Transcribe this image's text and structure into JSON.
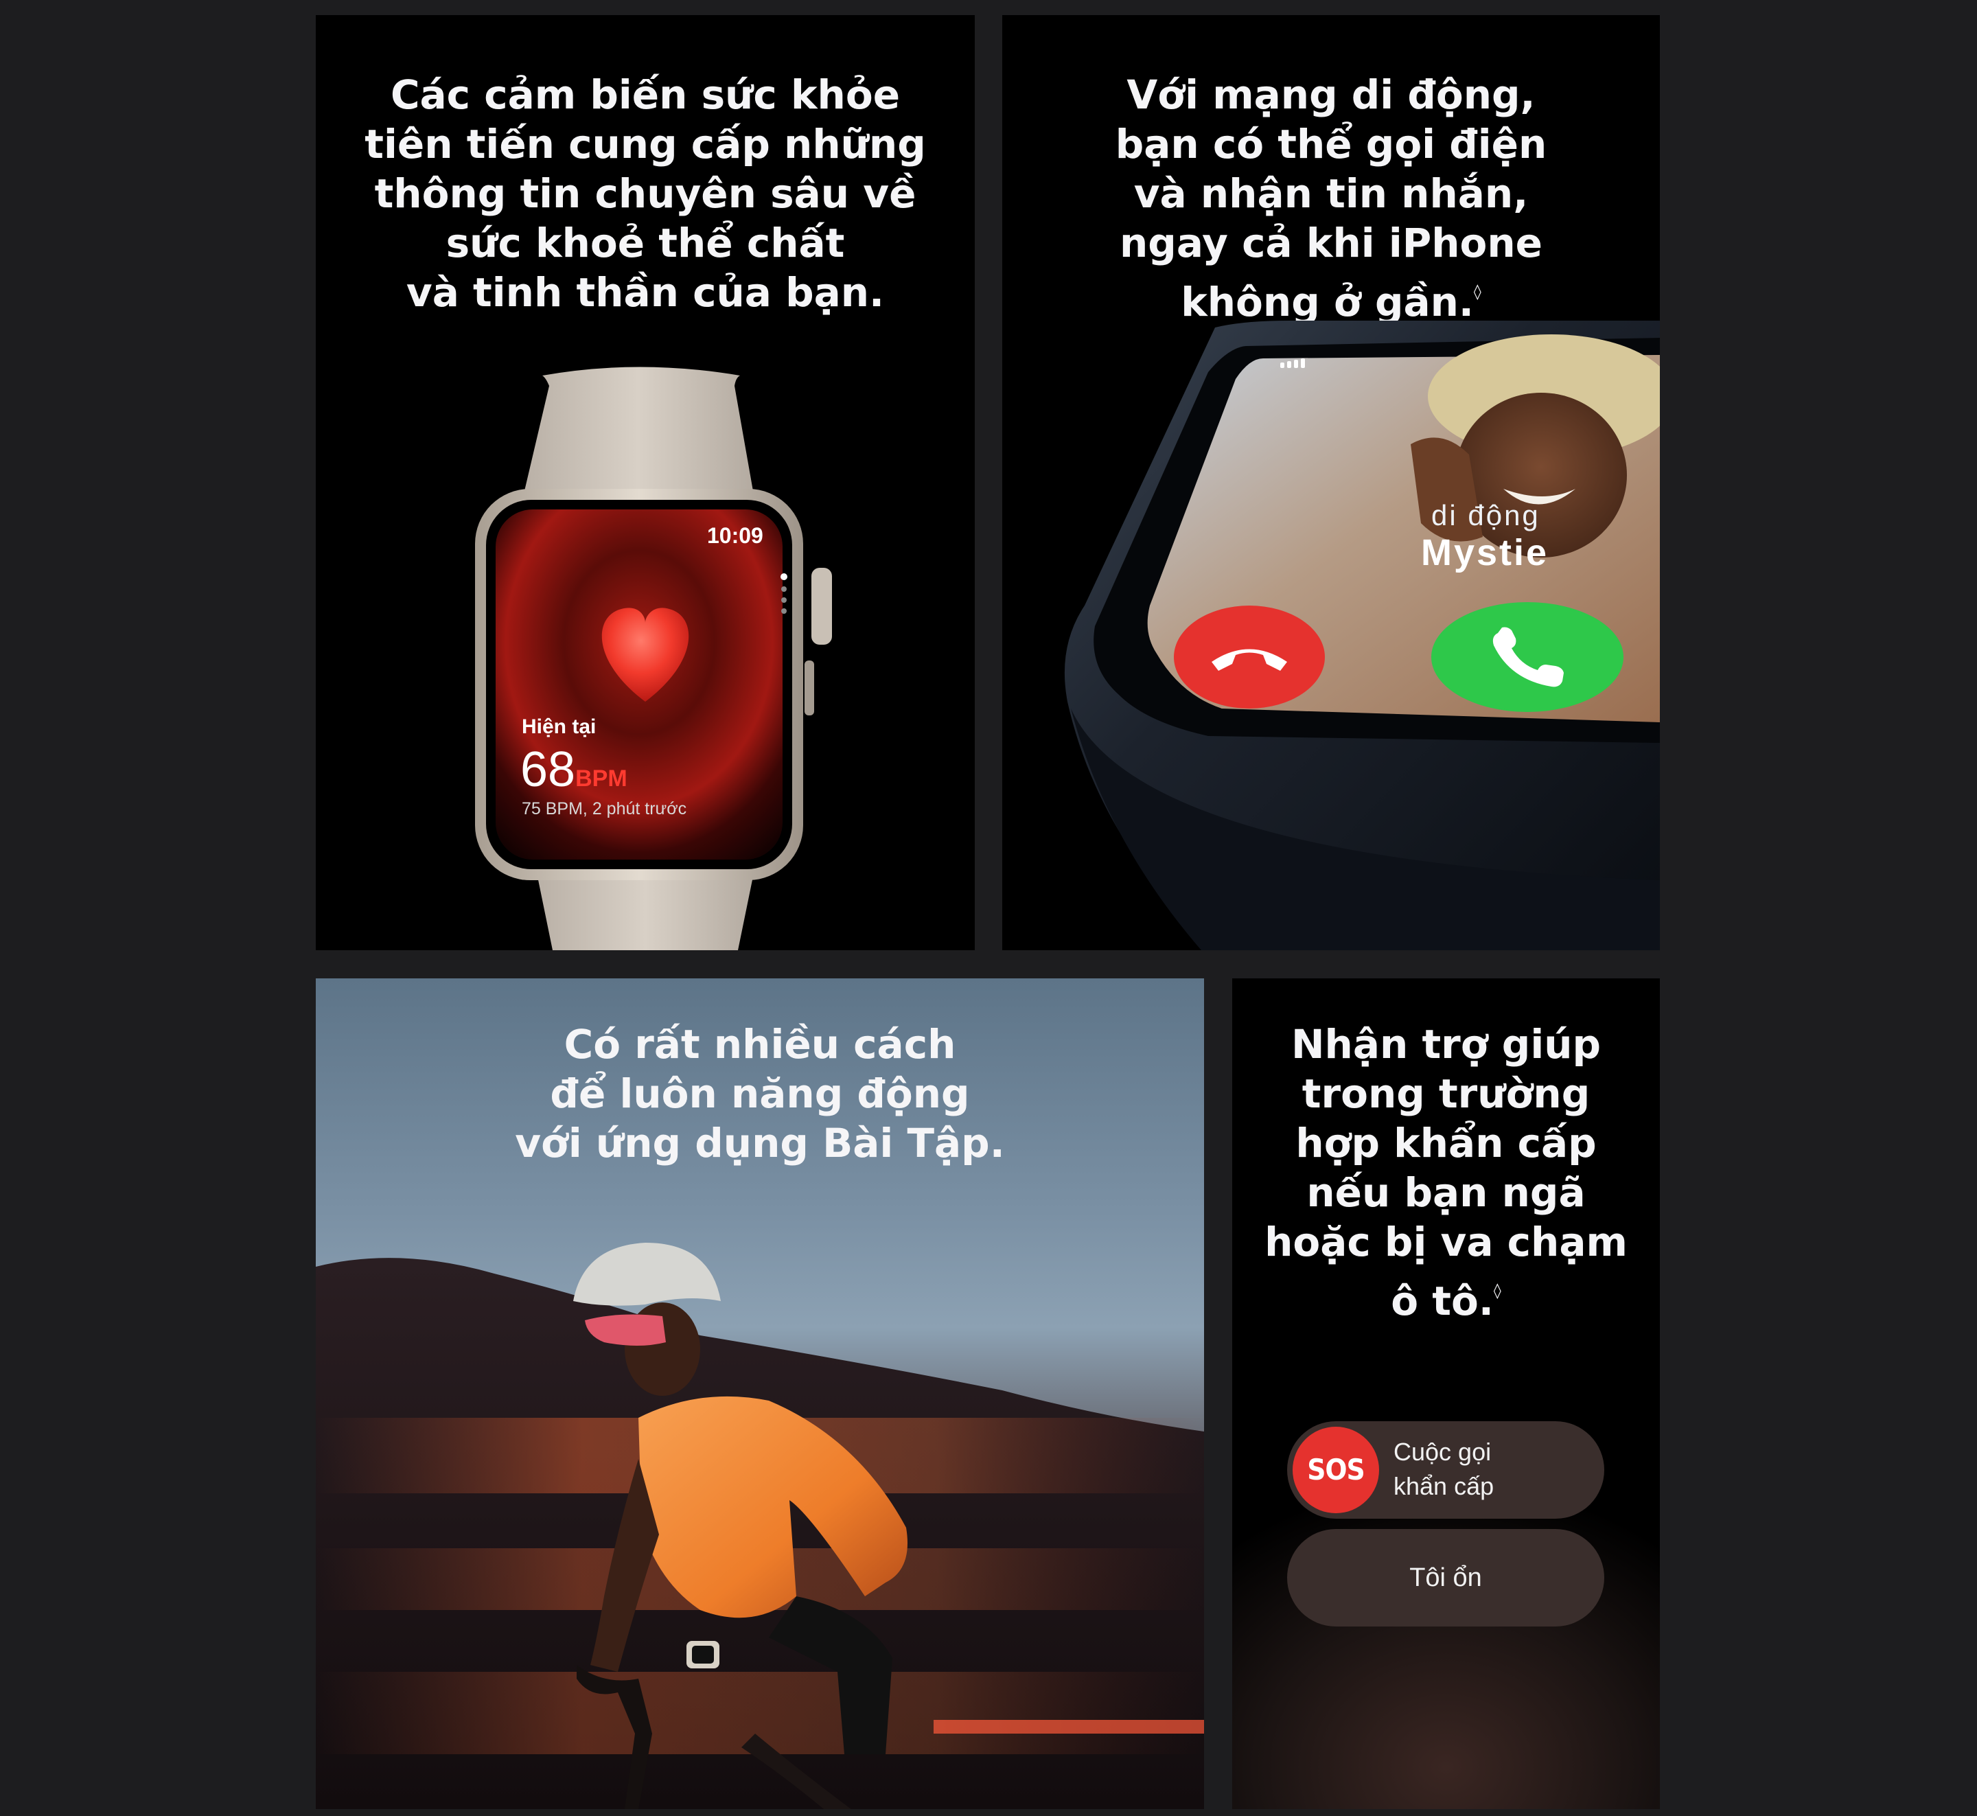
{
  "tiles": {
    "health": {
      "headline": "Các cảm biến sức khỏe\ntiên tiến cung cấp những\nthông tin chuyên sâu về\nsức khoẻ thể chất\nvà tinh thần của bạn.",
      "watch": {
        "time": "10:09",
        "label": "Hiện tại",
        "value": "68",
        "unit": "BPM",
        "subtext": "75 BPM, 2 phút trước"
      }
    },
    "cellular": {
      "headline": "Với mạng di động,\nbạn có thể gọi điện\nvà nhận tin nhắn,\nngay cả khi iPhone\nkhông ở gần.",
      "footnote": "◊",
      "watch": {
        "caller_type": "di động",
        "caller_name": "Mystie"
      }
    },
    "workout": {
      "headline": "Có rất nhiều cách\nđể luôn năng động\nvới ứng dụng Bài Tập."
    },
    "sos": {
      "headline": "Nhận trợ giúp\ntrong trường\nhợp khẩn cấp\nnếu bạn ngã\nhoặc bị va chạm\nô tô.",
      "footnote": "◊",
      "sos_badge": "SOS",
      "emergency_call_label": "Cuộc gọi\nkhẩn cấp",
      "ok_label": "Tôi ổn"
    }
  },
  "colors": {
    "page_bg": "#1d1d1f",
    "decline_red": "#e5322e",
    "accept_green": "#2ec84a",
    "bpm_red": "#ff3b30"
  }
}
